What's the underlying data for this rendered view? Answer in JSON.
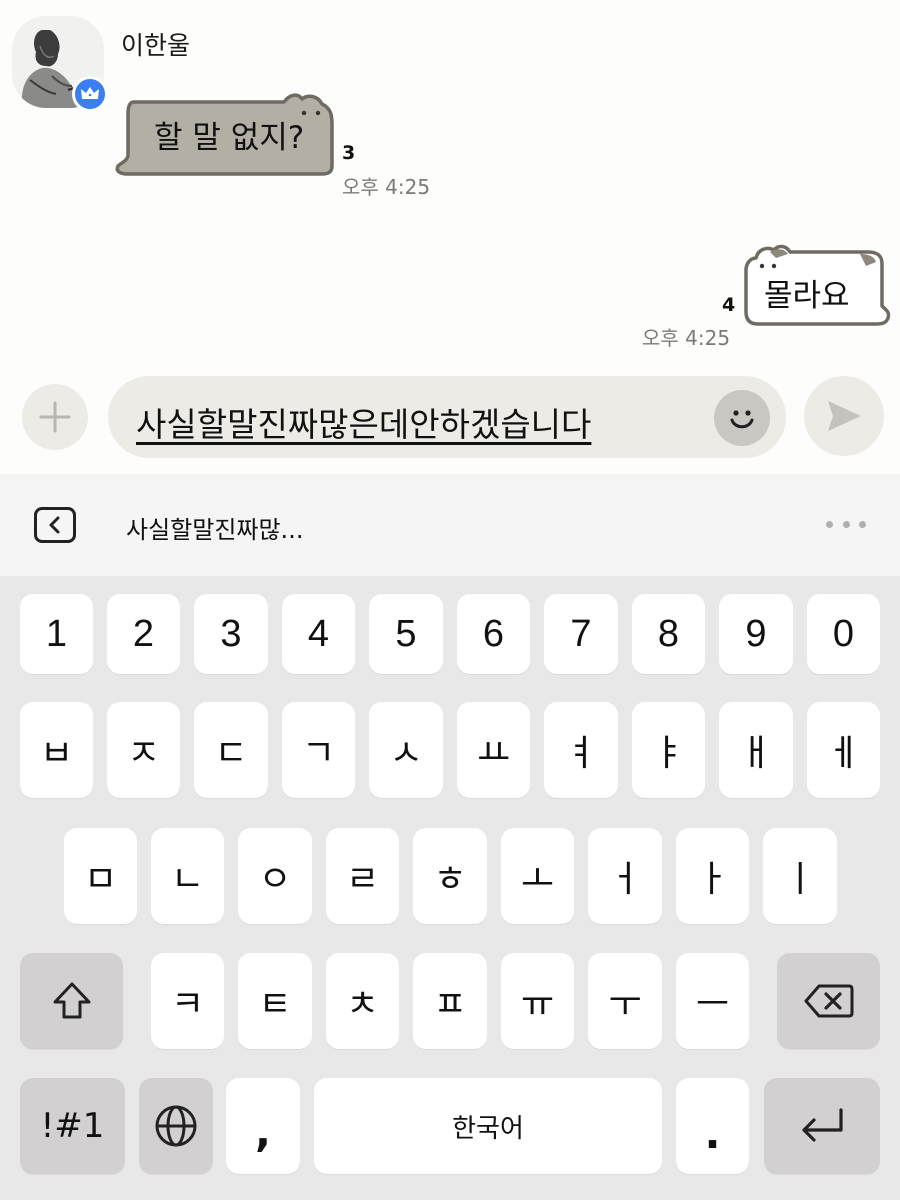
{
  "chat": {
    "sender_name": "이한울",
    "incoming": {
      "text": "할 말 없지?",
      "unread": "3",
      "time": "오후 4:25"
    },
    "outgoing": {
      "text": "몰라요",
      "unread": "4",
      "time": "오후 4:25"
    }
  },
  "input": {
    "plus_icon": "plus-icon",
    "text": "사실할말진짜많은데안하겠습니다",
    "emoji_icon": "emoji-icon",
    "send_icon": "send-icon"
  },
  "suggestion": {
    "back_icon": "chevron-left-icon",
    "text": "사실할말진짜많...",
    "more_icon": "more-icon"
  },
  "keyboard": {
    "numbers": [
      "1",
      "2",
      "3",
      "4",
      "5",
      "6",
      "7",
      "8",
      "9",
      "0"
    ],
    "row1": [
      "ㅂ",
      "ㅈ",
      "ㄷ",
      "ㄱ",
      "ㅅ",
      "ㅛ",
      "ㅕ",
      "ㅑ",
      "ㅐ",
      "ㅔ"
    ],
    "row2": [
      "ㅁ",
      "ㄴ",
      "ㅇ",
      "ㄹ",
      "ㅎ",
      "ㅗ",
      "ㅓ",
      "ㅏ",
      "ㅣ"
    ],
    "row3": [
      "ㅋ",
      "ㅌ",
      "ㅊ",
      "ㅍ",
      "ㅠ",
      "ㅜ",
      "ㅡ"
    ],
    "symbols_label": "!#1",
    "comma": ",",
    "space_label": "한국어",
    "period": "."
  },
  "colors": {
    "incoming_bubble": "#b3afa4",
    "outgoing_bubble": "#ffffff",
    "bubble_outline": "#6f6a62",
    "badge_blue": "#3a7ff2",
    "function_key": "#d2d0d0"
  }
}
